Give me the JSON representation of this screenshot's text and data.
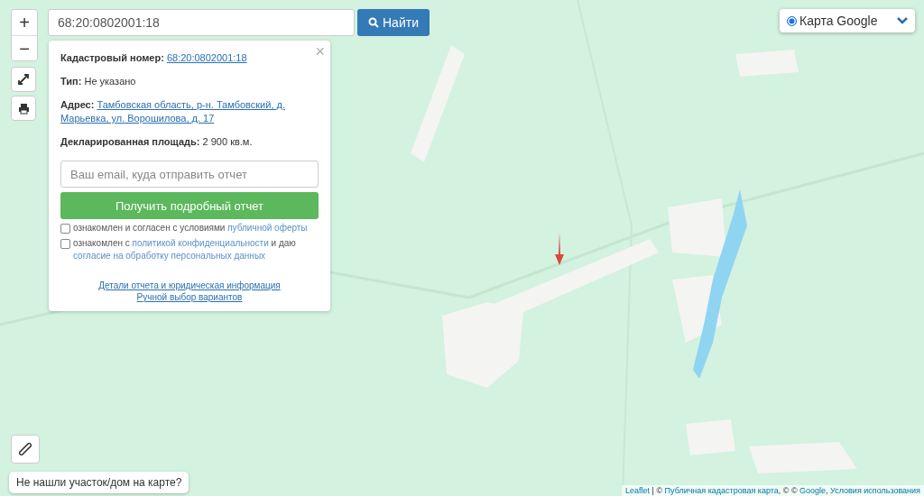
{
  "zoom_controls": [
    "+",
    "−"
  ],
  "search": {
    "value": "68:20:0802001:18",
    "button": "Найти"
  },
  "layer_switch": {
    "label": "Карта Google",
    "selected": true
  },
  "popup": {
    "close": "×",
    "cadastral": {
      "label": "Кадастровый номер:",
      "value": "68:20:0802001:18"
    },
    "type": {
      "label": "Тип:",
      "value": "Не указано"
    },
    "address": {
      "label": "Адрес:",
      "lines": [
        "Тамбовская область, р-н. Тамбовский, д.",
        "Марьевка, ул. Ворошилова, д. 17"
      ]
    },
    "area": {
      "label": "Декларированная площадь:",
      "value": "2 900 кв.м."
    },
    "email": {
      "placeholder": "Ваш email, куда отправить отчет"
    },
    "report_button": "Получить подробный отчет",
    "consents": [
      {
        "checked": false,
        "before": "ознакомлен и согласен с условиями ",
        "link": "публичной оферты"
      },
      {
        "checked": false,
        "before": "ознакомлен с ",
        "link": "политикой конфиденциальности",
        "middle": " и даю ",
        "link2": "согласие на обработку персональных данных"
      }
    ],
    "links": [
      "Детали отчета и юридическая информация",
      "Ручной выбор вариантов"
    ]
  },
  "not_found_button": "Не нашли участок/дом на карте?",
  "attribution": [
    {
      "kind": "link",
      "text": "Leaflet"
    },
    {
      "kind": "text",
      "text": " | © "
    },
    {
      "kind": "link",
      "text": "Публичная кадастровая карта"
    },
    {
      "kind": "text",
      "text": ", © © "
    },
    {
      "kind": "link",
      "text": "Google"
    },
    {
      "kind": "text",
      "text": ", "
    },
    {
      "kind": "link",
      "text": "Условия использования"
    }
  ]
}
